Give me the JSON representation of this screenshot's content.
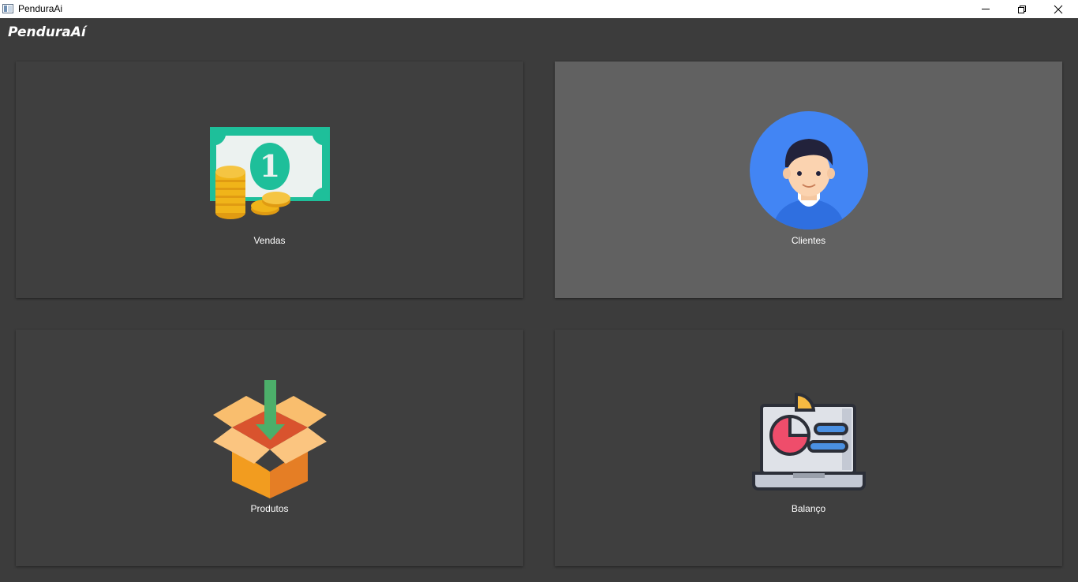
{
  "window": {
    "title": "PenduraAi",
    "icon": "app-window-icon",
    "controls": [
      "minimize-icon",
      "restore-icon",
      "close-icon"
    ]
  },
  "header": {
    "title": "PenduraAí"
  },
  "tiles": [
    {
      "label": "Vendas",
      "icon": "money-coins-icon"
    },
    {
      "label": "Clientes",
      "icon": "user-avatar-icon",
      "highlighted": true
    },
    {
      "label": "Produtos",
      "icon": "box-download-icon"
    },
    {
      "label": "Balanço",
      "icon": "laptop-chart-icon"
    }
  ],
  "colors": {
    "background": "#3c3c3c",
    "tile": "#3f3f3f",
    "tile_hover": "#616161",
    "text": "#ffffff"
  }
}
